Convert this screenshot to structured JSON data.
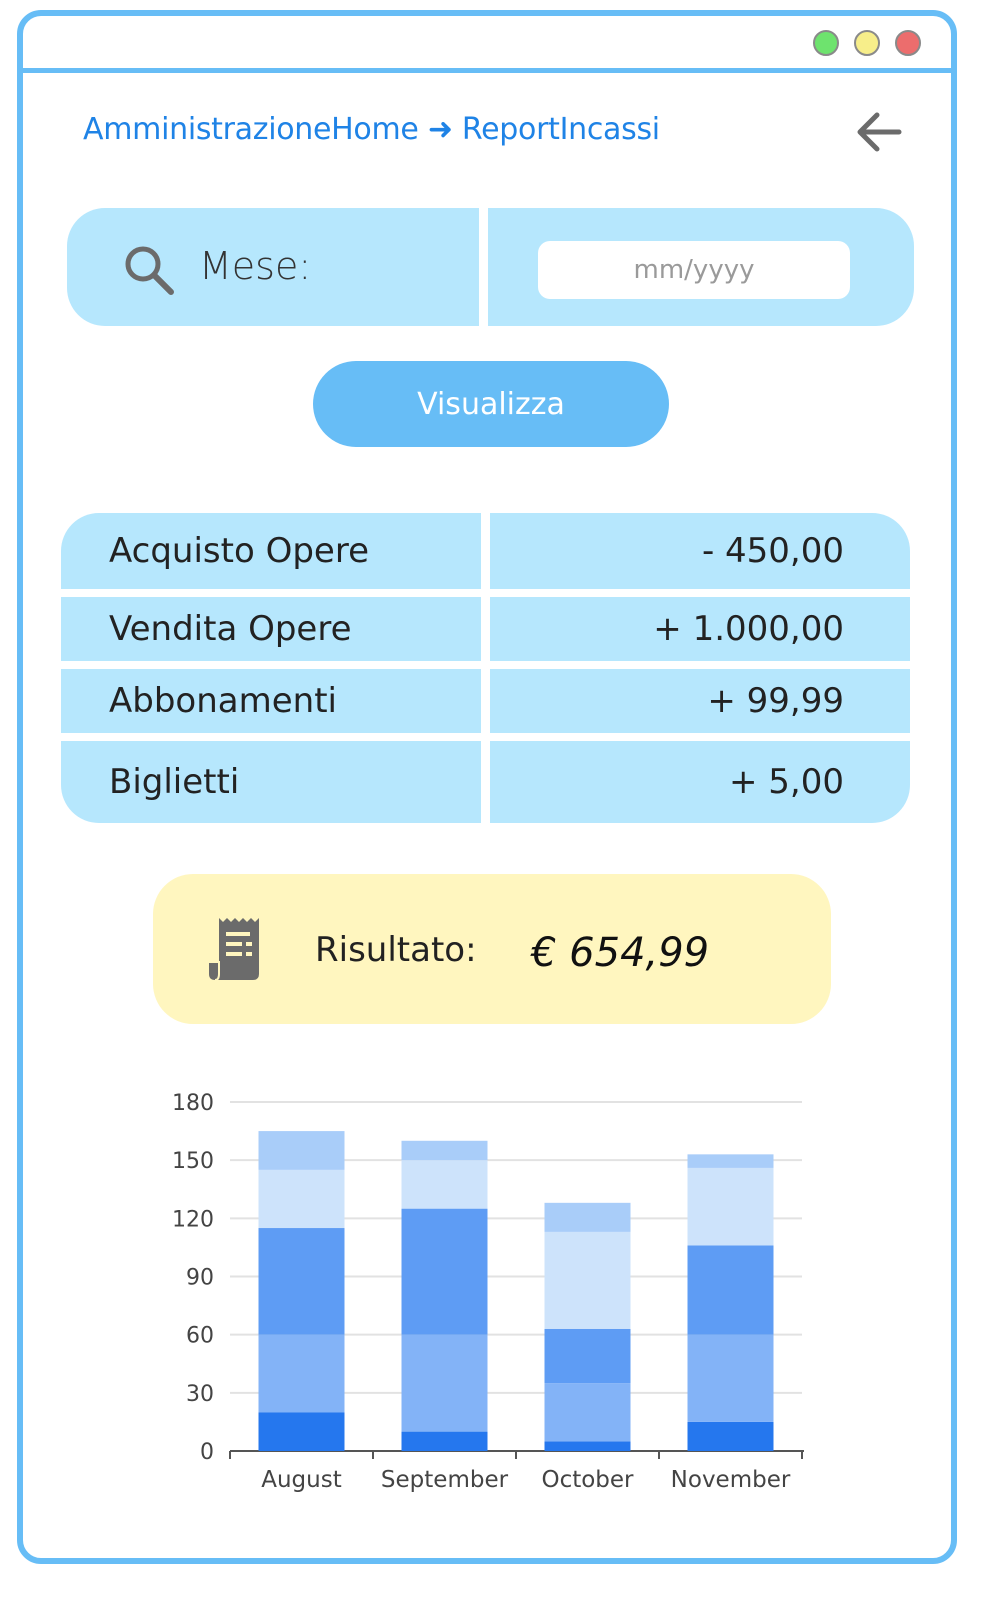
{
  "breadcrumb": {
    "home": "AmministrazioneHome",
    "arrow": "➜",
    "current": "ReportIncassi"
  },
  "search": {
    "label": "Mese:",
    "placeholder": "mm/yyyy",
    "value": ""
  },
  "actions": {
    "show_label": "Visualizza"
  },
  "report": {
    "rows": [
      {
        "label": "Acquisto Opere",
        "value": "- 450,00"
      },
      {
        "label": "Vendita Opere",
        "value": "+ 1.000,00"
      },
      {
        "label": "Abbonamenti",
        "value": "+ 99,99"
      },
      {
        "label": "Biglietti",
        "value": "+ 5,00"
      }
    ]
  },
  "result": {
    "label": "Risultato:",
    "value": "€ 654,99"
  },
  "colors": {
    "accent": "#67bdf6",
    "panel": "#b6e7fd",
    "result_bg": "#fff6bf",
    "link": "#1f83e6"
  },
  "icons": [
    "back-arrow-icon",
    "search-icon",
    "receipt-icon"
  ],
  "chart_data": {
    "type": "bar",
    "stacked": true,
    "categories": [
      "August",
      "September",
      "October",
      "November"
    ],
    "series": [
      {
        "color": "#2577ee",
        "values": [
          20,
          10,
          5,
          15
        ]
      },
      {
        "color": "#83b3f7",
        "values": [
          40,
          50,
          30,
          45
        ]
      },
      {
        "color": "#5e9cf4",
        "values": [
          55,
          65,
          28,
          46
        ]
      },
      {
        "color": "#cde3fb",
        "values": [
          30,
          25,
          50,
          40
        ]
      },
      {
        "color": "#a9cdf9",
        "values": [
          20,
          10,
          15,
          7
        ]
      }
    ],
    "ylim": [
      0,
      180
    ],
    "yticks": [
      0,
      30,
      60,
      90,
      120,
      150,
      180
    ],
    "grid": true,
    "title": "",
    "xlabel": "",
    "ylabel": ""
  }
}
